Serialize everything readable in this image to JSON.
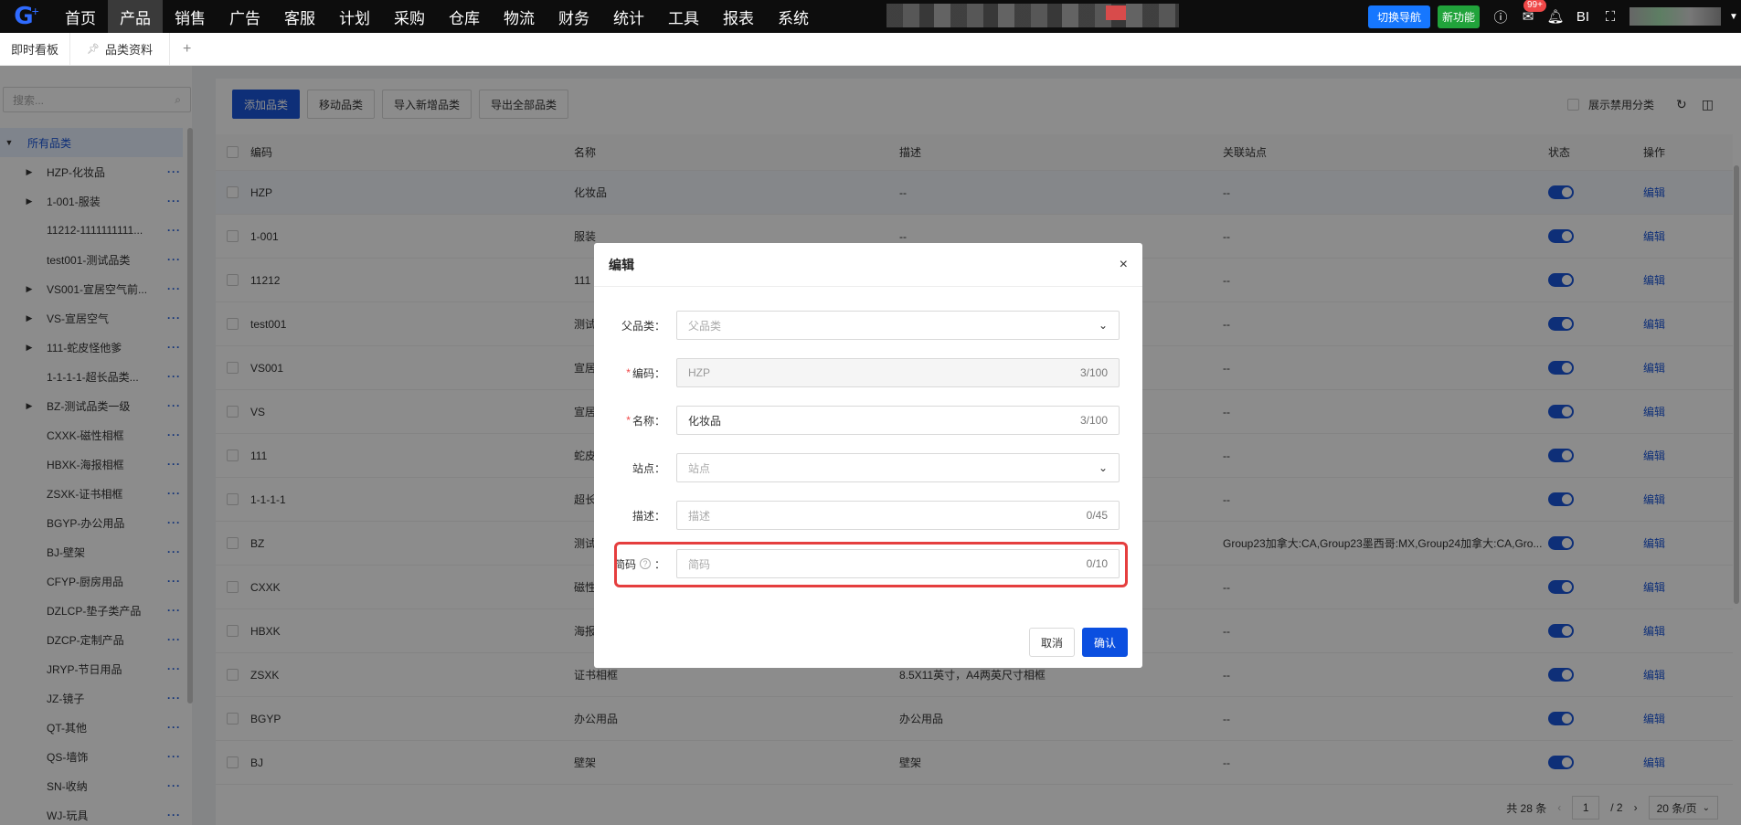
{
  "topnav": {
    "menu": [
      "首页",
      "产品",
      "销售",
      "广告",
      "客服",
      "计划",
      "采购",
      "仓库",
      "物流",
      "财务",
      "统计",
      "工具",
      "报表",
      "系统"
    ],
    "active_index": 1,
    "switch_nav": "切换导航",
    "new_feature": "新功能",
    "notification_badge": "99+",
    "bi_label": "BI"
  },
  "tabs": {
    "dashboard": "即时看板",
    "current": "品类资料",
    "add": "+"
  },
  "sidebar": {
    "search_placeholder": "搜索...",
    "root": "所有品类",
    "items": [
      {
        "label": "HZP-化妆品",
        "expandable": true
      },
      {
        "label": "1-001-服装",
        "expandable": true
      },
      {
        "label": "11212-1111111111...",
        "expandable": false
      },
      {
        "label": "test001-测试品类",
        "expandable": false
      },
      {
        "label": "VS001-宣居空气前...",
        "expandable": true
      },
      {
        "label": "VS-宣居空气",
        "expandable": true
      },
      {
        "label": "111-蛇皮怪他爹",
        "expandable": true
      },
      {
        "label": "1-1-1-1-超长品类...",
        "expandable": false
      },
      {
        "label": "BZ-测试品类一级",
        "expandable": true
      },
      {
        "label": "CXXK-磁性相框",
        "expandable": false
      },
      {
        "label": "HBXK-海报相框",
        "expandable": false
      },
      {
        "label": "ZSXK-证书相框",
        "expandable": false
      },
      {
        "label": "BGYP-办公用品",
        "expandable": false
      },
      {
        "label": "BJ-壁架",
        "expandable": false
      },
      {
        "label": "CFYP-厨房用品",
        "expandable": false
      },
      {
        "label": "DZLCP-垫子类产品",
        "expandable": false
      },
      {
        "label": "DZCP-定制产品",
        "expandable": false
      },
      {
        "label": "JRYP-节日用品",
        "expandable": false
      },
      {
        "label": "JZ-镜子",
        "expandable": false
      },
      {
        "label": "QT-其他",
        "expandable": false
      },
      {
        "label": "QS-墙饰",
        "expandable": false
      },
      {
        "label": "SN-收纳",
        "expandable": false
      },
      {
        "label": "WJ-玩具",
        "expandable": false
      }
    ],
    "more_glyph": "···"
  },
  "toolbar": {
    "add": "添加品类",
    "move": "移动品类",
    "import": "导入新增品类",
    "export": "导出全部品类",
    "show_disabled": "展示禁用分类"
  },
  "table": {
    "headers": {
      "code": "编码",
      "name": "名称",
      "desc": "描述",
      "sites": "关联站点",
      "status": "状态",
      "action": "操作"
    },
    "rows": [
      {
        "code": "HZP",
        "name": "化妆品",
        "desc": "--",
        "sites": "--",
        "action": "编辑"
      },
      {
        "code": "1-001",
        "name": "服装",
        "desc": "--",
        "sites": "--",
        "action": "编辑"
      },
      {
        "code": "11212",
        "name": "111",
        "desc": "",
        "sites": "--",
        "action": "编辑"
      },
      {
        "code": "test001",
        "name": "测试",
        "desc": "",
        "sites": "--",
        "action": "编辑"
      },
      {
        "code": "VS001",
        "name": "宣居",
        "desc": "",
        "sites": "--",
        "action": "编辑"
      },
      {
        "code": "VS",
        "name": "宣居",
        "desc": "",
        "sites": "--",
        "action": "编辑"
      },
      {
        "code": "111",
        "name": "蛇皮",
        "desc": "",
        "sites": "--",
        "action": "编辑"
      },
      {
        "code": "1-1-1-1",
        "name": "超长",
        "desc": "",
        "sites": "--",
        "action": "编辑"
      },
      {
        "code": "BZ",
        "name": "测试",
        "desc": "",
        "sites": "Group23加拿大:CA,Group23墨西哥:MX,Group24加拿大:CA,Gro...",
        "action": "编辑"
      },
      {
        "code": "CXXK",
        "name": "磁性",
        "desc": "",
        "sites": "--",
        "action": "编辑"
      },
      {
        "code": "HBXK",
        "name": "海报",
        "desc": "",
        "sites": "--",
        "action": "编辑"
      },
      {
        "code": "ZSXK",
        "name": "证书相框",
        "desc": "8.5X11英寸，A4两英尺寸相框",
        "sites": "--",
        "action": "编辑"
      },
      {
        "code": "BGYP",
        "name": "办公用品",
        "desc": "办公用品",
        "sites": "--",
        "action": "编辑"
      },
      {
        "code": "BJ",
        "name": "壁架",
        "desc": "壁架",
        "sites": "--",
        "action": "编辑"
      }
    ]
  },
  "pagination": {
    "total": "共 28 条",
    "current_page": "1",
    "total_pages": "/ 2",
    "page_size": "20 条/页"
  },
  "modal": {
    "title": "编辑",
    "close": "×",
    "fields": {
      "parent": {
        "label": "父品类",
        "placeholder": "父品类"
      },
      "code": {
        "label": "编码",
        "value": "HZP",
        "count": "3/100"
      },
      "name": {
        "label": "名称",
        "value": "化妆品",
        "count": "3/100"
      },
      "site": {
        "label": "站点",
        "placeholder": "站点"
      },
      "desc": {
        "label": "描述",
        "placeholder": "描述",
        "count": "0/45"
      },
      "short_code": {
        "label": "简码",
        "placeholder": "简码",
        "count": "0/10"
      }
    },
    "colon": "：",
    "required_mark": "*",
    "cancel": "取消",
    "confirm": "确认"
  }
}
